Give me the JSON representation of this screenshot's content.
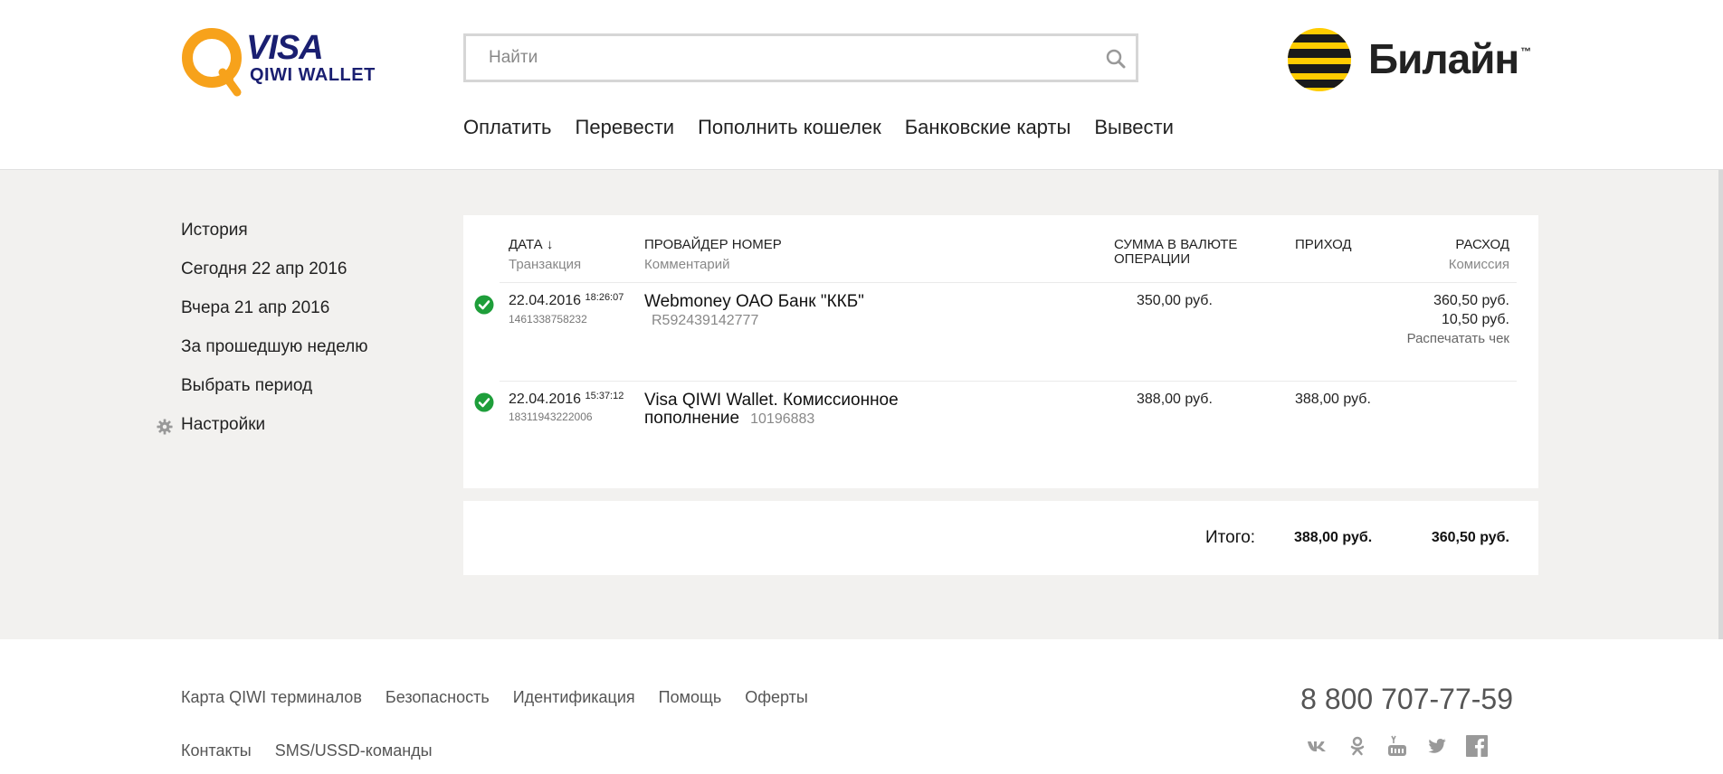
{
  "header": {
    "logo": {
      "visa": "VISA",
      "wallet": "QIWI WALLET"
    },
    "search": {
      "placeholder": "Найти",
      "value": ""
    },
    "operator": {
      "name": "Билайн",
      "tm": "™"
    },
    "nav": [
      "Оплатить",
      "Перевести",
      "Пополнить кошелек",
      "Банковские карты",
      "Вывести"
    ]
  },
  "sidebar": {
    "items": [
      "История",
      "Сегодня 22 апр 2016",
      "Вчера 21 апр 2016",
      "За прошедшую неделю",
      "Выбрать период"
    ],
    "settings": "Настройки"
  },
  "table": {
    "columns": {
      "date": "ДАТА ↓",
      "date_sub": "Транзакция",
      "provider": "ПРОВАЙДЕР НОМЕР",
      "provider_sub": "Комментарий",
      "amount": "СУММА В ВАЛЮТЕ ОПЕРАЦИИ",
      "income": "ПРИХОД",
      "expense": "РАСХОД",
      "expense_sub": "Комиссия"
    },
    "rows": [
      {
        "date": "22.04.2016",
        "time": "18:26:07",
        "txn_id": "1461338758232",
        "provider": "Webmoney ОАО Банк \"ККБ\"",
        "comment": "R592439142777",
        "amount": "350,00 руб.",
        "income": "",
        "expense": "360,50 руб.",
        "commission": "10,50 руб.",
        "action": "Распечатать чек"
      },
      {
        "date": "22.04.2016",
        "time": "15:37:12",
        "txn_id": "18311943222006",
        "provider_line1": "Visa QIWI Wallet. Комиссионное",
        "provider_line2": "пополнение",
        "comment": "10196883",
        "amount": "388,00 руб.",
        "income": "388,00 руб.",
        "expense": ""
      }
    ]
  },
  "totals": {
    "label": "Итого:",
    "income": "388,00 руб.",
    "expense": "360,50 руб."
  },
  "footer": {
    "links_row1": [
      "Карта QIWI терминалов",
      "Безопасность",
      "Идентификация",
      "Помощь",
      "Оферты"
    ],
    "links_row2": [
      "Контакты",
      "SMS/USSD-команды"
    ],
    "phone": "8 800 707-77-59",
    "socials": [
      "vk-icon",
      "odnoklassniki-icon",
      "youtube-icon",
      "twitter-icon",
      "facebook-icon"
    ]
  },
  "colors": {
    "qiwi_orange": "#f7a21b",
    "visa_blue": "#1a1f71",
    "beeline_yellow": "#ffcc00",
    "success_green": "#1e9e3a",
    "page_bg": "#f2f1ef"
  }
}
